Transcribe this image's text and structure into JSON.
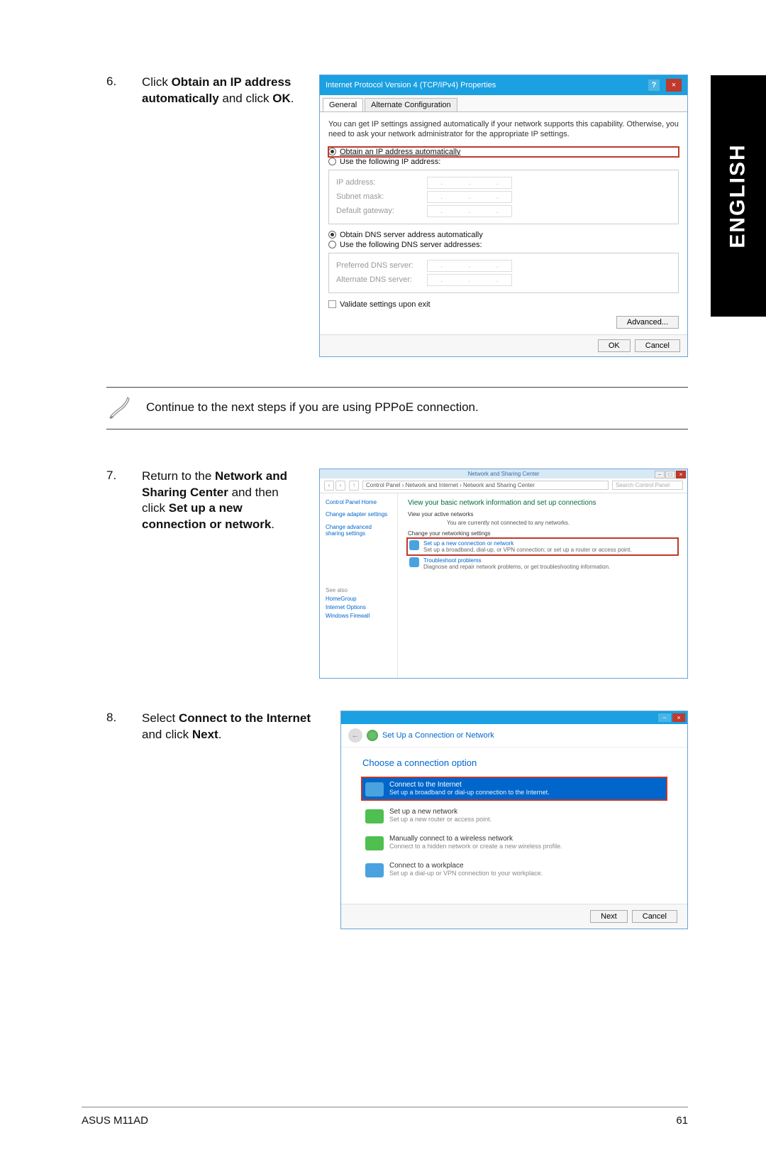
{
  "lang_tab": "ENGLISH",
  "step6": {
    "num": "6.",
    "text_a": "Click ",
    "text_b": "Obtain an IP address automatically",
    "text_c": " and click ",
    "text_d": "OK",
    "text_e": "."
  },
  "ipv4": {
    "title": "Internet Protocol Version 4 (TCP/IPv4) Properties",
    "tab_general": "General",
    "tab_alternate": "Alternate Configuration",
    "intro": "You can get IP settings assigned automatically if your network supports this capability. Otherwise, you need to ask your network administrator for the appropriate IP settings.",
    "r_obtain_ip": "Obtain an IP address automatically",
    "r_use_ip": "Use the following IP address:",
    "f_ip": "IP address:",
    "f_mask": "Subnet mask:",
    "f_gw": "Default gateway:",
    "r_obtain_dns": "Obtain DNS server address automatically",
    "r_use_dns": "Use the following DNS server addresses:",
    "f_pdns": "Preferred DNS server:",
    "f_adns": "Alternate DNS server:",
    "chk_validate": "Validate settings upon exit",
    "btn_adv": "Advanced...",
    "btn_ok": "OK",
    "btn_cancel": "Cancel",
    "help": "?",
    "close": "×"
  },
  "note": {
    "text": "Continue to the next steps if you are using PPPoE connection."
  },
  "step7": {
    "num": "7.",
    "text_a": "Return to the ",
    "text_b": "Network and Sharing Center",
    "text_c": " and then click ",
    "text_d": "Set up a new connection or network",
    "text_e": "."
  },
  "nsc": {
    "title": "Network and Sharing Center",
    "crumb": "Control Panel  ›  Network and Internet  ›  Network and Sharing Center",
    "search": "Search Control Panel",
    "back": "‹",
    "fwd": "›",
    "up": "↑",
    "min": "−",
    "max": "□",
    "close": "×",
    "side_home": "Control Panel Home",
    "side_adapter": "Change adapter settings",
    "side_sharing": "Change advanced sharing settings",
    "h": "View your basic network information and set up connections",
    "view_active": "View your active networks",
    "not_connected": "You are currently not connected to any networks.",
    "change_settings": "Change your networking settings",
    "opt1_t": "Set up a new connection or network",
    "opt1_s": "Set up a broadband, dial-up, or VPN connection; or set up a router or access point.",
    "opt2_t": "Troubleshoot problems",
    "opt2_s": "Diagnose and repair network problems, or get troubleshooting information.",
    "sa": "See also",
    "sa1": "HomeGroup",
    "sa2": "Internet Options",
    "sa3": "Windows Firewall"
  },
  "step8": {
    "num": "8.",
    "text_a": "Select ",
    "text_b": "Connect to the Internet",
    "text_c": " and click ",
    "text_d": "Next",
    "text_e": "."
  },
  "wiz": {
    "hdr": "Set Up a Connection or Network",
    "back": "←",
    "min": "−",
    "close": "×",
    "q": "Choose a connection option",
    "o1t": "Connect to the Internet",
    "o1s": "Set up a broadband or dial-up connection to the Internet.",
    "o2t": "Set up a new network",
    "o2s": "Set up a new router or access point.",
    "o3t": "Manually connect to a wireless network",
    "o3s": "Connect to a hidden network or create a new wireless profile.",
    "o4t": "Connect to a workplace",
    "o4s": "Set up a dial-up or VPN connection to your workplace.",
    "btn_next": "Next",
    "btn_cancel": "Cancel"
  },
  "footer": {
    "left": "ASUS M11AD",
    "right": "61"
  }
}
